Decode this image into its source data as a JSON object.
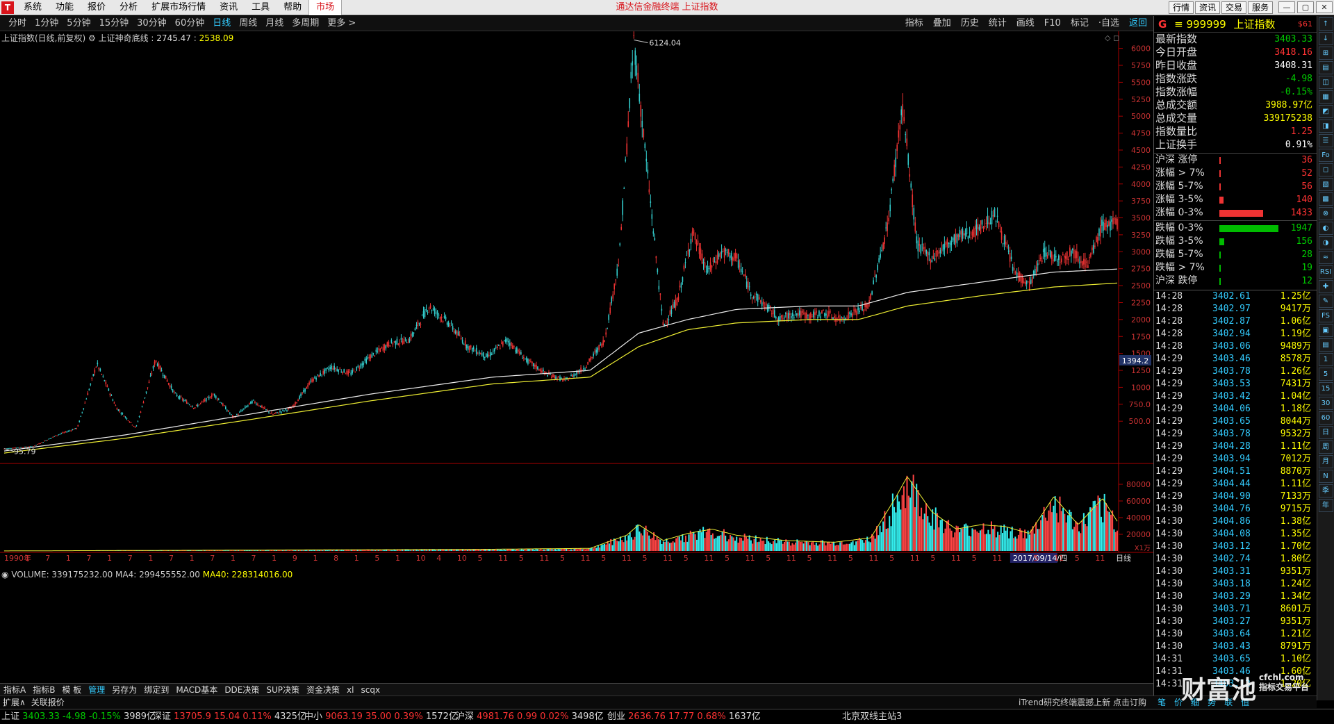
{
  "menubar": {
    "logo": "T",
    "items": [
      "系统",
      "功能",
      "报价",
      "分析",
      "扩展市场行情",
      "资讯",
      "工具",
      "帮助",
      "市场"
    ],
    "app_title": "通达信金融终端  上证指数",
    "right_buttons": [
      "行情",
      "资讯",
      "交易",
      "服务"
    ]
  },
  "toolbar": {
    "periods": [
      "分时",
      "1分钟",
      "5分钟",
      "15分钟",
      "30分钟",
      "60分钟",
      "日线",
      "周线",
      "月线",
      "多周期",
      "更多 >"
    ],
    "tools": [
      "指标",
      "叠加",
      "历史",
      "统计",
      "画线",
      "F10",
      "标记",
      "·自选",
      "返回"
    ]
  },
  "legend": {
    "title": "上证指数(日线,前复权)",
    "indicator": "上证神奇底线 : ",
    "v1": "2745.47",
    "v2": "2538.09"
  },
  "volume_legend": {
    "volume": "VOLUME: 339175232.00",
    "ma4": "MA4: 299455552.00",
    "ma40": "MA40: 228314016.00"
  },
  "chart_data": {
    "type": "candlestick",
    "title": "上证指数(日线,前复权)",
    "price_axis": {
      "ticks": [
        500,
        750,
        1000,
        1250,
        1500,
        1750,
        2000,
        2250,
        2500,
        2750,
        3000,
        3250,
        3500,
        3750,
        4000,
        4250,
        4500,
        4750,
        5000,
        5250,
        5500,
        5750,
        6000
      ],
      "ylim": [
        0,
        6150
      ]
    },
    "annotations": {
      "high": "6124.04",
      "low": "95.79",
      "current_marker": "1394.2"
    },
    "x_labels": [
      "1990年",
      "1",
      "7",
      "1",
      "7",
      "1",
      "7",
      "1",
      "7",
      "1",
      "7",
      "1",
      "7",
      "1",
      "9",
      "1",
      "8",
      "1",
      "5",
      "1",
      "10",
      "4",
      "10",
      "5",
      "11",
      "5",
      "11",
      "5",
      "11",
      "5",
      "11",
      "5",
      "11",
      "5",
      "11",
      "5",
      "11",
      "5",
      "11",
      "5",
      "11",
      "5",
      "11",
      "5",
      "11",
      "5",
      "11",
      "5",
      "11",
      "2017/09/14/四",
      "5",
      "11",
      "5",
      "11",
      "日线"
    ],
    "close_series": [
      {
        "t": 0.0,
        "v": 96
      },
      {
        "t": 1.2,
        "v": 130
      },
      {
        "t": 2.2,
        "v": 300
      },
      {
        "t": 3.0,
        "v": 400
      },
      {
        "t": 3.8,
        "v": 1350
      },
      {
        "t": 4.6,
        "v": 700
      },
      {
        "t": 5.4,
        "v": 400
      },
      {
        "t": 6.2,
        "v": 1400
      },
      {
        "t": 7.0,
        "v": 900
      },
      {
        "t": 7.8,
        "v": 700
      },
      {
        "t": 8.6,
        "v": 900
      },
      {
        "t": 9.4,
        "v": 550
      },
      {
        "t": 10.2,
        "v": 800
      },
      {
        "t": 11.0,
        "v": 600
      },
      {
        "t": 11.8,
        "v": 700
      },
      {
        "t": 12.6,
        "v": 1100
      },
      {
        "t": 13.4,
        "v": 1300
      },
      {
        "t": 14.2,
        "v": 1200
      },
      {
        "t": 15.0,
        "v": 1450
      },
      {
        "t": 15.8,
        "v": 1650
      },
      {
        "t": 16.6,
        "v": 1700
      },
      {
        "t": 17.4,
        "v": 2200
      },
      {
        "t": 18.2,
        "v": 1950
      },
      {
        "t": 19.0,
        "v": 1600
      },
      {
        "t": 19.8,
        "v": 1450
      },
      {
        "t": 20.6,
        "v": 1700
      },
      {
        "t": 21.4,
        "v": 1400
      },
      {
        "t": 22.2,
        "v": 1200
      },
      {
        "t": 23.0,
        "v": 1100
      },
      {
        "t": 23.8,
        "v": 1300
      },
      {
        "t": 24.6,
        "v": 1700
      },
      {
        "t": 25.2,
        "v": 2900
      },
      {
        "t": 25.8,
        "v": 6124
      },
      {
        "t": 26.4,
        "v": 4000
      },
      {
        "t": 27.0,
        "v": 1900
      },
      {
        "t": 27.6,
        "v": 2300
      },
      {
        "t": 28.2,
        "v": 3300
      },
      {
        "t": 28.8,
        "v": 2700
      },
      {
        "t": 29.4,
        "v": 3000
      },
      {
        "t": 30.0,
        "v": 2900
      },
      {
        "t": 30.6,
        "v": 2400
      },
      {
        "t": 31.2,
        "v": 2200
      },
      {
        "t": 31.8,
        "v": 2000
      },
      {
        "t": 32.4,
        "v": 2100
      },
      {
        "t": 33.0,
        "v": 2050
      },
      {
        "t": 33.6,
        "v": 2100
      },
      {
        "t": 34.2,
        "v": 2000
      },
      {
        "t": 34.8,
        "v": 2100
      },
      {
        "t": 35.4,
        "v": 2200
      },
      {
        "t": 36.2,
        "v": 3400
      },
      {
        "t": 36.8,
        "v": 5170
      },
      {
        "t": 37.4,
        "v": 3100
      },
      {
        "t": 38.0,
        "v": 2900
      },
      {
        "t": 38.6,
        "v": 3100
      },
      {
        "t": 39.2,
        "v": 3250
      },
      {
        "t": 39.8,
        "v": 3300
      },
      {
        "t": 40.6,
        "v": 3550
      },
      {
        "t": 41.4,
        "v": 2700
      },
      {
        "t": 42.0,
        "v": 2500
      },
      {
        "t": 42.6,
        "v": 3000
      },
      {
        "t": 43.2,
        "v": 2900
      },
      {
        "t": 43.8,
        "v": 3000
      },
      {
        "t": 44.4,
        "v": 2800
      },
      {
        "t": 45.0,
        "v": 3400
      },
      {
        "t": 45.6,
        "v": 3403
      }
    ],
    "ma_white": [
      {
        "t": 0,
        "v": 60
      },
      {
        "t": 5,
        "v": 300
      },
      {
        "t": 10,
        "v": 600
      },
      {
        "t": 15,
        "v": 900
      },
      {
        "t": 20,
        "v": 1150
      },
      {
        "t": 24,
        "v": 1250
      },
      {
        "t": 26,
        "v": 1800
      },
      {
        "t": 28,
        "v": 2000
      },
      {
        "t": 30,
        "v": 2150
      },
      {
        "t": 33,
        "v": 2200
      },
      {
        "t": 35,
        "v": 2200
      },
      {
        "t": 37,
        "v": 2400
      },
      {
        "t": 40,
        "v": 2550
      },
      {
        "t": 43,
        "v": 2700
      },
      {
        "t": 45.6,
        "v": 2745
      }
    ],
    "ma_yellow": [
      {
        "t": 0,
        "v": 30
      },
      {
        "t": 5,
        "v": 250
      },
      {
        "t": 10,
        "v": 520
      },
      {
        "t": 15,
        "v": 800
      },
      {
        "t": 20,
        "v": 1050
      },
      {
        "t": 24,
        "v": 1150
      },
      {
        "t": 26,
        "v": 1600
      },
      {
        "t": 28,
        "v": 1850
      },
      {
        "t": 30,
        "v": 1950
      },
      {
        "t": 33,
        "v": 2000
      },
      {
        "t": 35,
        "v": 2000
      },
      {
        "t": 37,
        "v": 2200
      },
      {
        "t": 40,
        "v": 2350
      },
      {
        "t": 43,
        "v": 2480
      },
      {
        "t": 45.6,
        "v": 2538
      }
    ],
    "volume_axis": {
      "ticks": [
        20000,
        40000,
        60000,
        80000
      ],
      "unit": "X1万"
    },
    "volume_profile": [
      {
        "t": 0,
        "v": 100
      },
      {
        "t": 10,
        "v": 1000
      },
      {
        "t": 20,
        "v": 2000
      },
      {
        "t": 24,
        "v": 3000
      },
      {
        "t": 25.5,
        "v": 18000
      },
      {
        "t": 26,
        "v": 30000
      },
      {
        "t": 27,
        "v": 12000
      },
      {
        "t": 28,
        "v": 20000
      },
      {
        "t": 29,
        "v": 25000
      },
      {
        "t": 30,
        "v": 18000
      },
      {
        "t": 32,
        "v": 12000
      },
      {
        "t": 34,
        "v": 10000
      },
      {
        "t": 35.5,
        "v": 15000
      },
      {
        "t": 36.5,
        "v": 60000
      },
      {
        "t": 37,
        "v": 85000
      },
      {
        "t": 38,
        "v": 45000
      },
      {
        "t": 39,
        "v": 25000
      },
      {
        "t": 40,
        "v": 30000
      },
      {
        "t": 41,
        "v": 28000
      },
      {
        "t": 42,
        "v": 20000
      },
      {
        "t": 43,
        "v": 62000
      },
      {
        "t": 44,
        "v": 30000
      },
      {
        "t": 45,
        "v": 60000
      },
      {
        "t": 45.6,
        "v": 34000
      }
    ]
  },
  "quote": {
    "g": "G",
    "code": "999999",
    "name": "上证指数",
    "tag": "$61",
    "rows": [
      {
        "label": "最新指数",
        "value": "3403.33",
        "color": "grn"
      },
      {
        "label": "今日开盘",
        "value": "3418.16",
        "color": "red"
      },
      {
        "label": "昨日收盘",
        "value": "3408.31",
        "color": "wht"
      },
      {
        "label": "指数涨跌",
        "value": "-4.98",
        "color": "grn"
      },
      {
        "label": "指数涨幅",
        "value": "-0.15%",
        "color": "grn"
      },
      {
        "label": "总成交额",
        "value": "3988.97亿",
        "color": "yel"
      },
      {
        "label": "总成交量",
        "value": "339175238",
        "color": "yel"
      },
      {
        "label": "指数量比",
        "value": "1.25",
        "color": "red"
      },
      {
        "label": "上证换手",
        "value": "0.91%",
        "color": "wht"
      }
    ],
    "breadth": [
      {
        "label": "沪深 涨停",
        "value": "36",
        "color": "red",
        "frac": 0.018
      },
      {
        "label": "涨幅 > 7%",
        "value": "52",
        "color": "red",
        "frac": 0.026
      },
      {
        "label": "涨幅 5-7%",
        "value": "56",
        "color": "red",
        "frac": 0.028
      },
      {
        "label": "涨幅 3-5%",
        "value": "140",
        "color": "red",
        "frac": 0.07
      },
      {
        "label": "涨幅 0-3%",
        "value": "1433",
        "color": "red",
        "frac": 0.74
      },
      {
        "label": "跌幅 0-3%",
        "value": "1947",
        "color": "grn",
        "frac": 1.0
      },
      {
        "label": "跌幅 3-5%",
        "value": "156",
        "color": "grn",
        "frac": 0.08
      },
      {
        "label": "跌幅 5-7%",
        "value": "28",
        "color": "grn",
        "frac": 0.014
      },
      {
        "label": "跌幅 > 7%",
        "value": "19",
        "color": "grn",
        "frac": 0.01
      },
      {
        "label": "沪深 跌停",
        "value": "12",
        "color": "grn",
        "frac": 0.006
      }
    ]
  },
  "ticks": [
    [
      "14:28",
      "3402.61",
      "1.25亿"
    ],
    [
      "14:28",
      "3402.97",
      "9417万"
    ],
    [
      "14:28",
      "3402.87",
      "1.06亿"
    ],
    [
      "14:28",
      "3402.94",
      "1.19亿"
    ],
    [
      "14:28",
      "3403.06",
      "9489万"
    ],
    [
      "14:29",
      "3403.46",
      "8578万"
    ],
    [
      "14:29",
      "3403.78",
      "1.26亿"
    ],
    [
      "14:29",
      "3403.53",
      "7431万"
    ],
    [
      "14:29",
      "3403.42",
      "1.04亿"
    ],
    [
      "14:29",
      "3404.06",
      "1.18亿"
    ],
    [
      "14:29",
      "3403.65",
      "8044万"
    ],
    [
      "14:29",
      "3403.78",
      "9532万"
    ],
    [
      "14:29",
      "3404.28",
      "1.11亿"
    ],
    [
      "14:29",
      "3403.94",
      "7012万"
    ],
    [
      "14:29",
      "3404.51",
      "8870万"
    ],
    [
      "14:29",
      "3404.44",
      "1.11亿"
    ],
    [
      "14:29",
      "3404.90",
      "7133万"
    ],
    [
      "14:30",
      "3404.76",
      "9715万"
    ],
    [
      "14:30",
      "3404.86",
      "1.38亿"
    ],
    [
      "14:30",
      "3404.08",
      "1.35亿"
    ],
    [
      "14:30",
      "3403.12",
      "1.70亿"
    ],
    [
      "14:30",
      "3402.74",
      "1.80亿"
    ],
    [
      "14:30",
      "3403.31",
      "9351万"
    ],
    [
      "14:30",
      "3403.18",
      "1.24亿"
    ],
    [
      "14:30",
      "3403.29",
      "1.34亿"
    ],
    [
      "14:30",
      "3403.71",
      "8601万"
    ],
    [
      "14:30",
      "3403.27",
      "9351万"
    ],
    [
      "14:30",
      "3403.64",
      "1.21亿"
    ],
    [
      "14:30",
      "3403.43",
      "8791万"
    ],
    [
      "14:31",
      "3403.65",
      "1.10亿"
    ],
    [
      "14:31",
      "3403.46",
      "1.60亿"
    ],
    [
      "14:31",
      "3403.12",
      "1.20亿"
    ]
  ],
  "icon_strip": [
    "↑",
    "↓",
    "⊞",
    "▤",
    "◫",
    "▦",
    "◩",
    "◨",
    "☰",
    "Fo",
    "◻",
    "▧",
    "▩",
    "⊗",
    "◐",
    "◑",
    "≈",
    "RSI",
    "✚",
    "✎",
    "FS",
    "▣",
    "▤",
    "1",
    "5",
    "15",
    "30",
    "60",
    "日",
    "周",
    "月",
    "N",
    "季",
    "年"
  ],
  "tabbar": [
    "指标A",
    "指标B",
    "模 板",
    "管理",
    "另存为",
    "绑定到",
    "MACD基本",
    "DDE决策",
    "SUP决策",
    "资金决策",
    "xl",
    "scqx"
  ],
  "tabbar2": {
    "left": [
      "扩展∧",
      "关联报价"
    ],
    "news": "iTrend研究终端震撼上新 点击订购"
  },
  "rtab": [
    "笔",
    "价",
    "细",
    "势",
    "联",
    "值"
  ],
  "watermark": {
    "main": "财富池",
    "site": "cfchl.com",
    "sub": "指标交易平台"
  },
  "status": {
    "items": [
      {
        "name": "上证",
        "price": "3403.33",
        "chg": "-4.98",
        "pct": "-0.15%",
        "amt": "3989亿",
        "color": "grn"
      },
      {
        "name": "深证",
        "price": "13705.9",
        "chg": "15.04",
        "pct": "0.11%",
        "amt": "4325亿",
        "color": "red"
      },
      {
        "name": "中小",
        "price": "9063.19",
        "chg": "35.00",
        "pct": "0.39%",
        "amt": "1572亿",
        "color": "red"
      },
      {
        "name": "沪深",
        "price": "4981.76",
        "chg": "0.99",
        "pct": "0.02%",
        "amt": "3498亿",
        "color": "red"
      },
      {
        "name": "创业",
        "price": "2636.76",
        "chg": "17.77",
        "pct": "0.68%",
        "amt": "1637亿",
        "color": "red"
      }
    ],
    "server": "北京双线主站3"
  }
}
